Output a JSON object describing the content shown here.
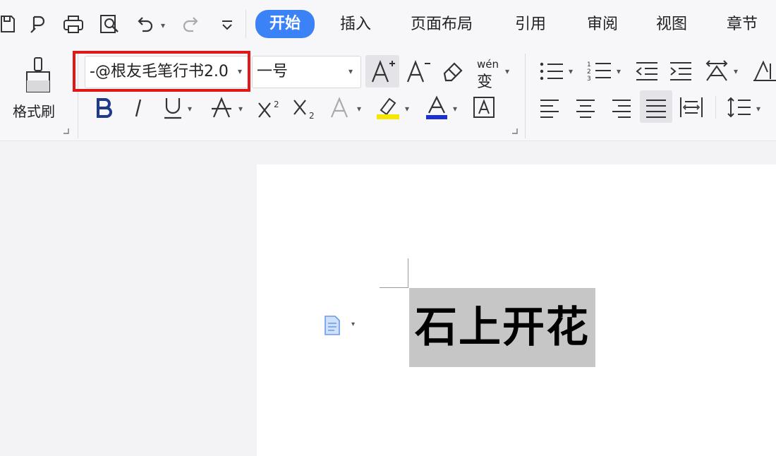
{
  "tabs": [
    {
      "label": "开始",
      "active": true
    },
    {
      "label": "插入"
    },
    {
      "label": "页面布局"
    },
    {
      "label": "引用"
    },
    {
      "label": "审阅"
    },
    {
      "label": "视图"
    },
    {
      "label": "章节"
    }
  ],
  "clipboard": {
    "format_painter_label": "格式刷"
  },
  "font": {
    "family_value": "-@根友毛笔行书2.0",
    "size_value": "一号"
  },
  "phonetic_label": "wén",
  "phonetic_char": "变",
  "document": {
    "selected_text": "石上开花"
  },
  "colors": {
    "accent": "#3b82f6",
    "highlight_yellow": "#f7e600",
    "font_color_blue": "#1a2fd6",
    "callout_red": "#e01818"
  }
}
